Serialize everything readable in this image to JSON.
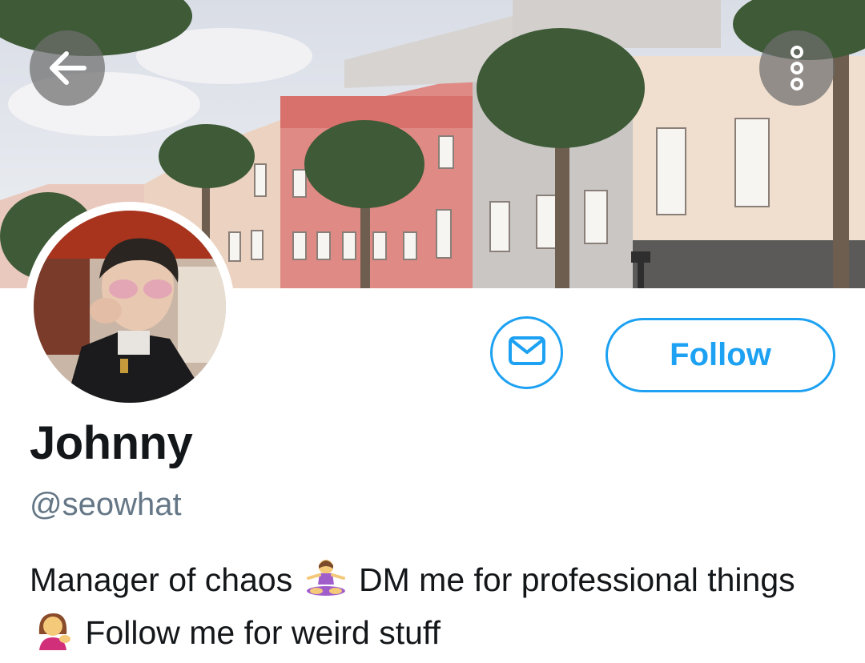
{
  "header": {
    "back_icon": "arrow-left-icon",
    "more_icon": "more-vertical-icon"
  },
  "profile": {
    "display_name": "Johnny",
    "handle": "@seowhat",
    "bio": {
      "part1": "Manager of chaos",
      "emoji1": "woman-in-lotus-position-emoji",
      "part2": "DM me for professional things",
      "emoji2": "woman-tipping-hand-emoji",
      "part3": "Follow me for weird stuff"
    }
  },
  "actions": {
    "dm_icon": "envelope-icon",
    "follow_label": "Follow"
  },
  "colors": {
    "accent": "#1da1f2",
    "text_primary": "#14171a",
    "text_secondary": "#657786"
  }
}
